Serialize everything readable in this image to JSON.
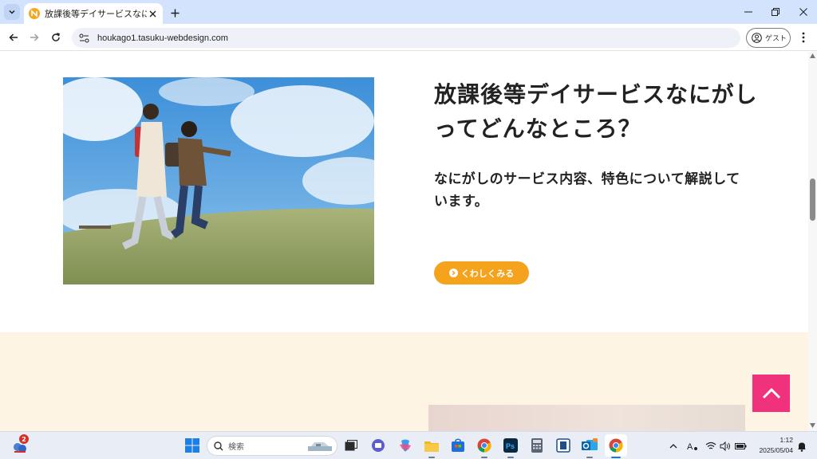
{
  "browser": {
    "tab": {
      "title": "放課後等デイサービスなにがし"
    },
    "url": "houkago1.tasuku-webdesign.com",
    "profile_label": "ゲスト",
    "icons": [
      "tab-search-icon",
      "favicon-icon",
      "close-icon",
      "plus-icon",
      "minimize-icon",
      "restore-icon",
      "close-window-icon",
      "back-arrow-icon",
      "forward-arrow-icon",
      "reload-icon",
      "site-info-icon",
      "profile-icon",
      "kebab-menu-icon"
    ]
  },
  "page": {
    "heading": "放課後等デイサービスなにがしってどんなところ？",
    "subtext": "なにがしのサービス内容、特色について解説しています。",
    "cta_label": "くわしくみる",
    "colors": {
      "cta": "#f5a21c",
      "to_top": "#f0317b",
      "next_section_bg": "#fdf4e3",
      "text": "#222222"
    },
    "icons": [
      "chevron-right-icon",
      "chevron-up-icon"
    ]
  },
  "taskbar": {
    "widget_badge": "2",
    "search_label": "検索",
    "clock_time": "1:12",
    "clock_date": "2025/05/04",
    "apps": [
      "start-icon",
      "task-view-icon",
      "teams-icon",
      "copilot-icon",
      "file-explorer-icon",
      "store-icon",
      "chrome-icon",
      "photoshop-icon",
      "calculator-icon",
      "snipping-icon",
      "outlook-icon",
      "chrome-active-icon"
    ],
    "tray_icons": [
      "chevron-up-icon",
      "ime-icon",
      "wifi-icon",
      "volume-icon",
      "battery-icon",
      "notification-icon"
    ]
  }
}
